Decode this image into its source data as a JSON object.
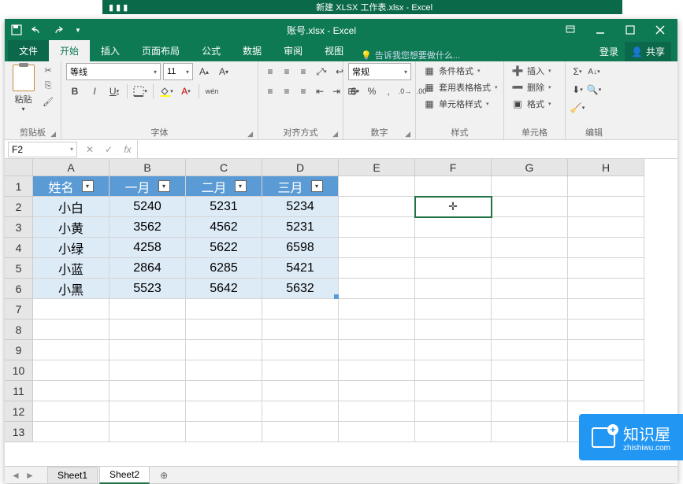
{
  "bg_window": {
    "title": "新建 XLSX 工作表.xlsx - Excel"
  },
  "title_bar": {
    "title": "账号.xlsx - Excel"
  },
  "tabs": {
    "file": "文件",
    "items": [
      "开始",
      "插入",
      "页面布局",
      "公式",
      "数据",
      "审阅",
      "视图"
    ],
    "active_index": 0,
    "tell_me": "告诉我您想要做什么...",
    "signin": "登录",
    "share": "共享"
  },
  "ribbon": {
    "clipboard": {
      "paste": "粘贴",
      "label": "剪贴板"
    },
    "font": {
      "name": "等线",
      "size": "11",
      "label": "字体",
      "bold": "B",
      "italic": "I",
      "underline": "U",
      "ruby": "wén"
    },
    "align": {
      "label": "对齐方式"
    },
    "number": {
      "format": "常规",
      "label": "数字"
    },
    "styles": {
      "cond": "条件格式",
      "table": "套用表格格式",
      "cell": "单元格样式",
      "label": "样式"
    },
    "cells": {
      "insert": "插入",
      "delete": "删除",
      "format": "格式",
      "label": "单元格"
    },
    "editing": {
      "label": "编辑"
    }
  },
  "name_box": "F2",
  "columns": [
    "A",
    "B",
    "C",
    "D",
    "E",
    "F",
    "G",
    "H"
  ],
  "rows": [
    1,
    2,
    3,
    4,
    5,
    6,
    7,
    8,
    9,
    10,
    11,
    12,
    13
  ],
  "table": {
    "headers": [
      "姓名",
      "一月",
      "二月",
      "三月"
    ],
    "data": [
      [
        "小白",
        "5240",
        "5231",
        "5234"
      ],
      [
        "小黄",
        "3562",
        "4562",
        "5231"
      ],
      [
        "小绿",
        "4258",
        "5622",
        "6598"
      ],
      [
        "小蓝",
        "2864",
        "6285",
        "5421"
      ],
      [
        "小黑",
        "5523",
        "5642",
        "5632"
      ]
    ]
  },
  "sheets": {
    "items": [
      "Sheet1",
      "Sheet2"
    ],
    "active_index": 1
  },
  "watermark": {
    "text": "知识屋",
    "sub": "zhishiwu.com"
  },
  "chart_data": {
    "type": "table",
    "title": "账号.xlsx",
    "columns": [
      "姓名",
      "一月",
      "二月",
      "三月"
    ],
    "rows": [
      {
        "姓名": "小白",
        "一月": 5240,
        "二月": 5231,
        "三月": 5234
      },
      {
        "姓名": "小黄",
        "一月": 3562,
        "二月": 4562,
        "三月": 5231
      },
      {
        "姓名": "小绿",
        "一月": 4258,
        "二月": 5622,
        "三月": 6598
      },
      {
        "姓名": "小蓝",
        "一月": 2864,
        "二月": 6285,
        "三月": 5421
      },
      {
        "姓名": "小黑",
        "一月": 5523,
        "二月": 5642,
        "三月": 5632
      }
    ]
  }
}
